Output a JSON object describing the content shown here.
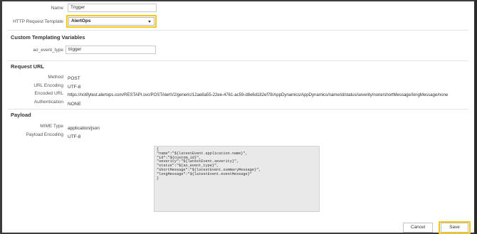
{
  "form": {
    "name_label": "Name",
    "name_value": "Trigger",
    "template_label": "HTTP Request Template",
    "template_value": "AlertOps"
  },
  "custom_vars": {
    "title": "Custom Templating Variables",
    "event_type_label": "ao_event_type",
    "event_type_value": "trigger"
  },
  "request_url": {
    "title": "Request URL",
    "method_label": "Method",
    "method_value": "POST",
    "url_encoding_label": "URL Encoding",
    "url_encoding_value": "UTF-8",
    "encoded_url_label": "Encoded URL",
    "encoded_url_value": "https://notifytest.alertops.com/RESTAPI.svc/POSTAlertV2/generic/12ae8a55-22ee-4761-ac59-d8e6d182ef78/AppDynamics/AppDynamics/name/id/status/severity/none/shortMessage/longMessage/none",
    "authentication_label": "Authentication",
    "authentication_value": "NONE"
  },
  "payload": {
    "title": "Payload",
    "mime_label": "MIME Type",
    "mime_value": "application/json",
    "encoding_label": "Payload Encoding",
    "encoding_value": "UTF-8",
    "body": "{\n\"name\":\"${latestEvent.application.name}\",\n\"id\":\"${custom_id}\",\n\"severity\":\"${latestEvent.severity}\",\n\"status\":\"${ao_event_type}\",\n\"shortMessage\":\"${latestEvent.summaryMessage}\",\n\"longMessage\":\"${latestEvent.eventMessage}\"\n}"
  },
  "footer": {
    "cancel_label": "Cancel",
    "save_label": "Save"
  },
  "colors": {
    "highlight": "#f5c518"
  }
}
